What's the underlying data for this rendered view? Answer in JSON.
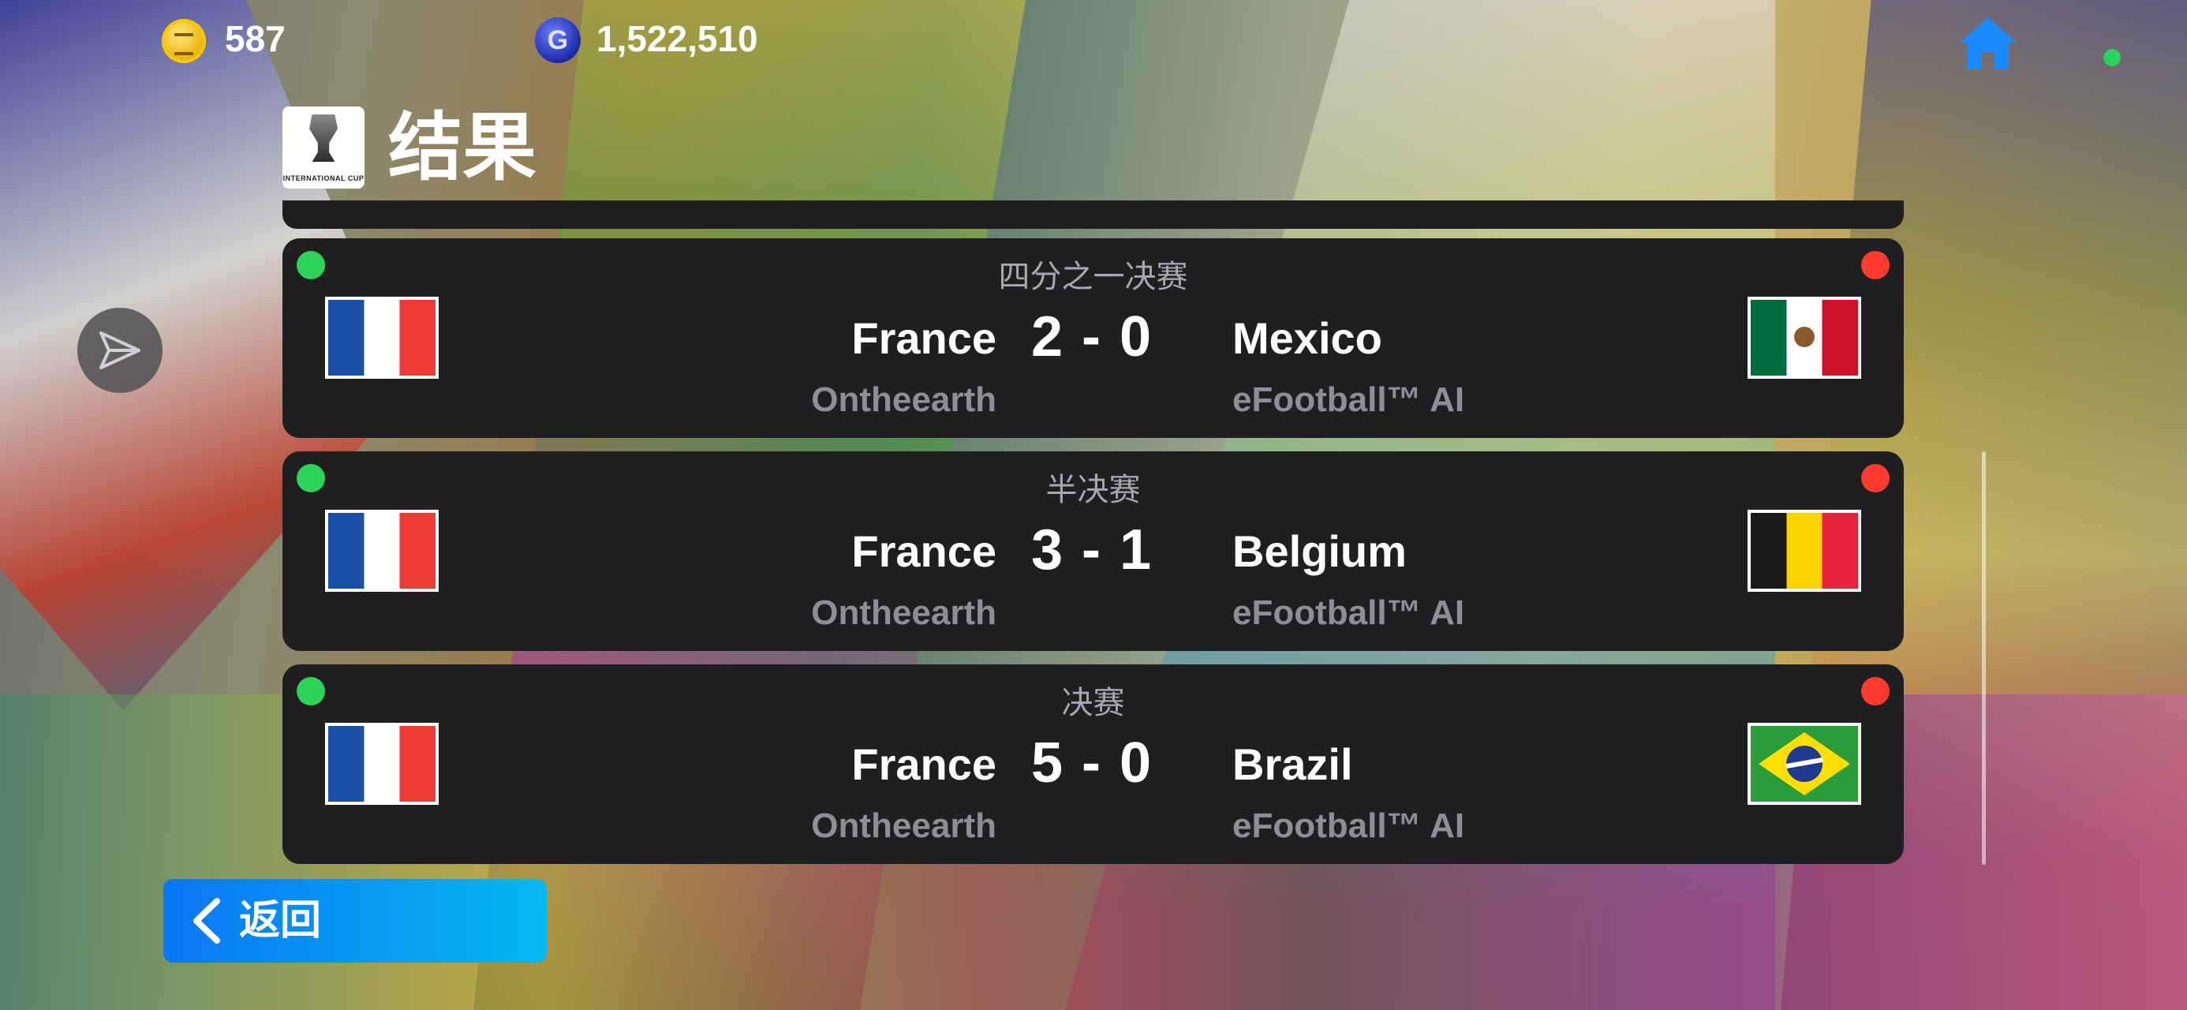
{
  "currency": {
    "coins": "587",
    "gp": "1,522,510",
    "gp_icon_letter": "G"
  },
  "header": {
    "title": "结果",
    "logo_text": "INTERNATIONAL CUP"
  },
  "icons": {
    "coin": "coin-icon",
    "gp": "gp-icon",
    "home": "home-icon",
    "share": "share-icon",
    "back": "chevron-left-icon"
  },
  "colors": {
    "win_dot": "#2ed35a",
    "loss_dot": "#ff3b30",
    "back_button_start": "#0a76f5",
    "back_button_end": "#06b8f0",
    "card_bg": "#1f1f22"
  },
  "results": [
    {
      "round": "四分之一决赛",
      "home_team": "France",
      "home_user": "Ontheearth",
      "home_score": "2",
      "away_score": "0",
      "away_team": "Mexico",
      "away_user": "eFootball™ AI",
      "home_flag": "france-flag",
      "away_flag": "mexico-flag"
    },
    {
      "round": "半决赛",
      "home_team": "France",
      "home_user": "Ontheearth",
      "home_score": "3",
      "away_score": "1",
      "away_team": "Belgium",
      "away_user": "eFootball™ AI",
      "home_flag": "france-flag",
      "away_flag": "belgium-flag"
    },
    {
      "round": "决赛",
      "home_team": "France",
      "home_user": "Ontheearth",
      "home_score": "5",
      "away_score": "0",
      "away_team": "Brazil",
      "away_user": "eFootball™ AI",
      "home_flag": "france-flag",
      "away_flag": "brazil-flag"
    }
  ],
  "score_separator": "-",
  "back_button": {
    "label": "返回"
  }
}
